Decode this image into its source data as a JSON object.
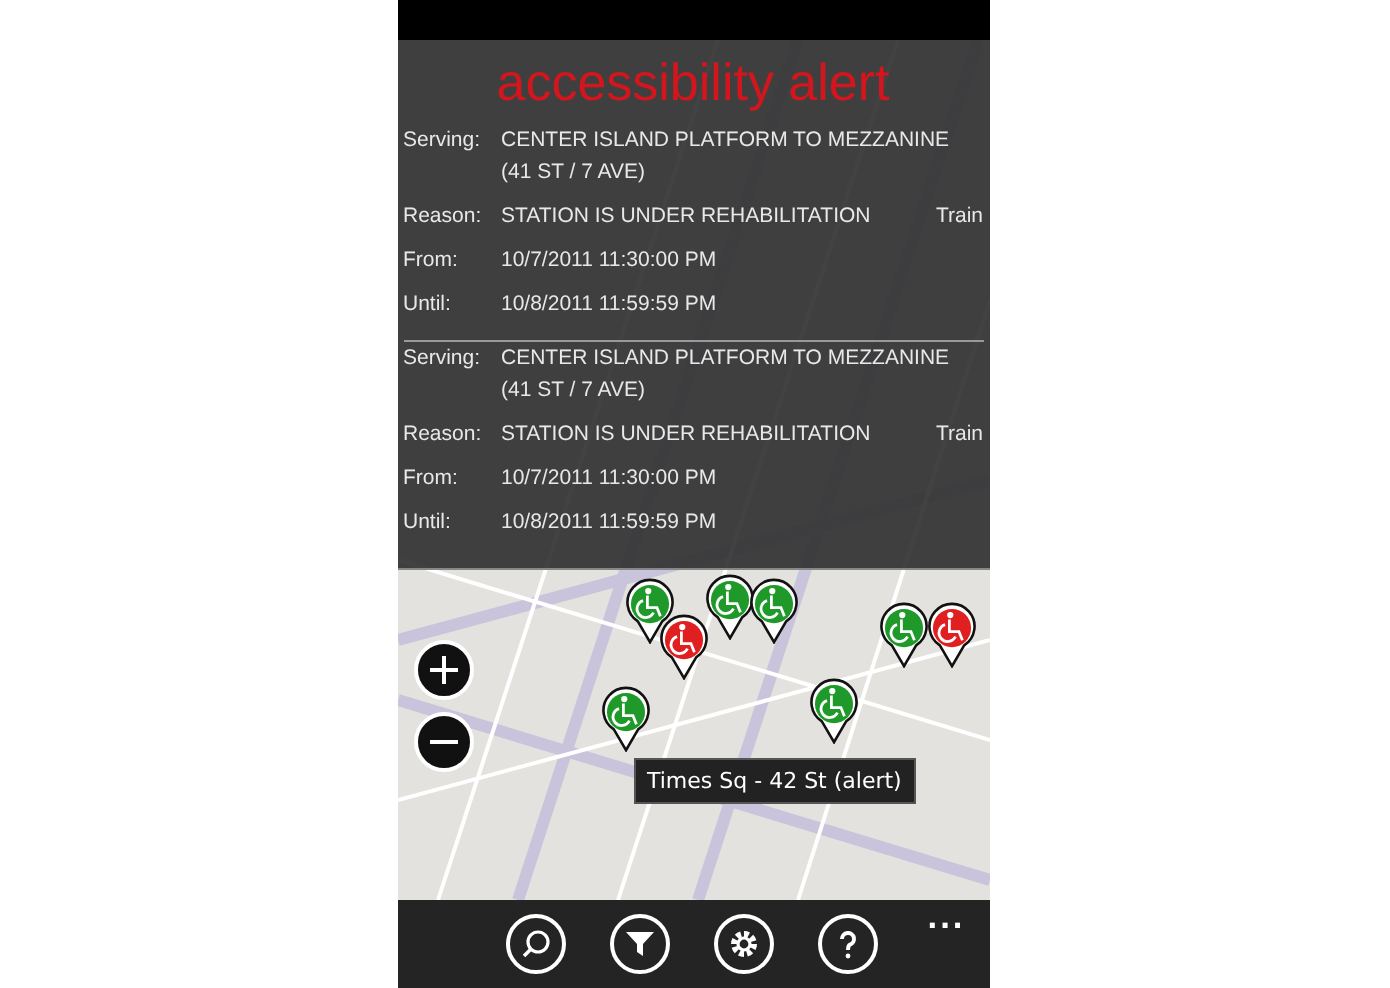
{
  "alert_panel": {
    "title": "accessibility alert",
    "alerts": [
      {
        "fields": [
          {
            "label": "Serving:",
            "value": "CENTER ISLAND PLATFORM TO MEZZANINE (41 ST / 7 AVE)"
          },
          {
            "label": "Reason:",
            "value": "STATION IS UNDER REHABILITATION",
            "extra": "Train"
          },
          {
            "label": "From:",
            "value": "10/7/2011 11:30:00 PM"
          },
          {
            "label": "Until:",
            "value": "10/8/2011 11:59:59 PM"
          }
        ]
      },
      {
        "fields": [
          {
            "label": "Serving:",
            "value": "CENTER ISLAND PLATFORM TO MEZZANINE (41 ST / 7 AVE)"
          },
          {
            "label": "Reason:",
            "value": "STATION IS UNDER REHABILITATION",
            "extra": "Train"
          },
          {
            "label": "From:",
            "value": "10/7/2011 11:30:00 PM"
          },
          {
            "label": "Until:",
            "value": "10/8/2011 11:59:59 PM"
          }
        ]
      }
    ]
  },
  "map": {
    "pins": [
      {
        "color": "#1f9a2a"
      },
      {
        "color": "#e02020"
      },
      {
        "color": "#1f9a2a"
      },
      {
        "color": "#1f9a2a"
      },
      {
        "color": "#1f9a2a"
      },
      {
        "color": "#e02020"
      },
      {
        "color": "#1f9a2a"
      },
      {
        "color": "#1f9a2a"
      }
    ],
    "tooltip": "Times Sq - 42 St (alert)"
  },
  "app_bar": {
    "buttons": [
      {
        "kind": "search"
      },
      {
        "kind": "filter"
      },
      {
        "kind": "settings"
      },
      {
        "kind": "help"
      }
    ],
    "more": "..."
  }
}
